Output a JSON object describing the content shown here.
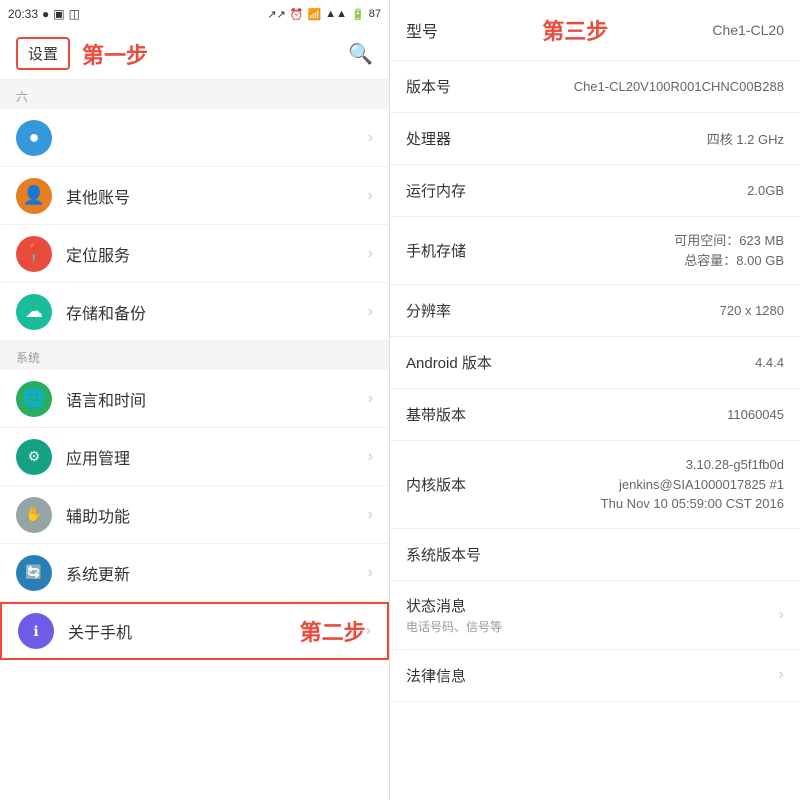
{
  "statusBar": {
    "time": "20:33",
    "battery": "87",
    "icons": "● ▣ ◫"
  },
  "leftPanel": {
    "settingsLabel": "设置",
    "stepOneLabel": "第一步",
    "searchIcon": "🔍",
    "sectionAbove": "六",
    "menuItems": [
      {
        "id": "item-blue-circle",
        "iconClass": "icon-blue",
        "iconSymbol": "●",
        "label": "",
        "hasArrow": true
      },
      {
        "id": "other-accounts",
        "iconClass": "icon-orange",
        "iconSymbol": "👤",
        "label": "其他账号",
        "hasArrow": true
      },
      {
        "id": "location-services",
        "iconClass": "icon-red",
        "iconSymbol": "📍",
        "label": "定位服务",
        "hasArrow": true
      },
      {
        "id": "storage-backup",
        "iconClass": "icon-cyan",
        "iconSymbol": "☁",
        "label": "存储和备份",
        "hasArrow": true
      }
    ],
    "sectionSystem": "系统",
    "systemItems": [
      {
        "id": "language-time",
        "iconClass": "icon-green-globe",
        "iconSymbol": "🌐",
        "label": "语言和时间",
        "hasArrow": true
      },
      {
        "id": "app-management",
        "iconClass": "icon-teal",
        "iconSymbol": "⚙",
        "label": "应用管理",
        "hasArrow": true
      },
      {
        "id": "accessibility",
        "iconClass": "icon-gray",
        "iconSymbol": "✋",
        "label": "辅助功能",
        "hasArrow": true
      },
      {
        "id": "system-update",
        "iconClass": "icon-blue-refresh",
        "iconSymbol": "🔄",
        "label": "系统更新",
        "hasArrow": true
      }
    ],
    "aboutItem": {
      "id": "about-phone",
      "iconClass": "icon-indigo",
      "iconSymbol": "ℹ",
      "label": "关于手机",
      "hasArrow": true
    },
    "stepTwoLabel": "第二步"
  },
  "rightPanel": {
    "modelLabel": "型号",
    "stepThreeLabel": "第三步",
    "modelValue": "Che1-CL20",
    "rows": [
      {
        "id": "version-number",
        "label": "版本号",
        "value": "Che1-CL20V100R001CHNC00B288",
        "clickable": false,
        "hasArrow": false
      },
      {
        "id": "processor",
        "label": "处理器",
        "value": "四核 1.2 GHz",
        "clickable": false,
        "hasArrow": false
      },
      {
        "id": "ram",
        "label": "运行内存",
        "value": "2.0GB",
        "clickable": false,
        "hasArrow": false
      },
      {
        "id": "storage",
        "label": "手机存储",
        "value": "可用空间：623 MB\n总容量：8.00 GB",
        "clickable": false,
        "hasArrow": false,
        "multiline": true
      },
      {
        "id": "resolution",
        "label": "分辨率",
        "value": "720 x 1280",
        "clickable": false,
        "hasArrow": false
      },
      {
        "id": "android-version",
        "label": "Android 版本",
        "value": "4.4.4",
        "clickable": false,
        "hasArrow": false
      },
      {
        "id": "baseband-version",
        "label": "基带版本",
        "value": "11060045",
        "clickable": false,
        "hasArrow": false
      },
      {
        "id": "kernel-version",
        "label": "内核版本",
        "value": "3.10.28-g5f1fb0d\njenkins@SIA1000017825 #1\nThu Nov 10 05:59:00 CST 2016",
        "clickable": false,
        "hasArrow": false,
        "multiline": true
      },
      {
        "id": "system-version",
        "label": "系统版本号",
        "value": "",
        "clickable": false,
        "hasArrow": false
      },
      {
        "id": "status-info",
        "label": "状态消息",
        "sublabel": "电话号码、信号等",
        "value": "",
        "clickable": true,
        "hasArrow": true
      },
      {
        "id": "legal-info",
        "label": "法律信息",
        "value": "",
        "clickable": true,
        "hasArrow": true
      }
    ]
  }
}
